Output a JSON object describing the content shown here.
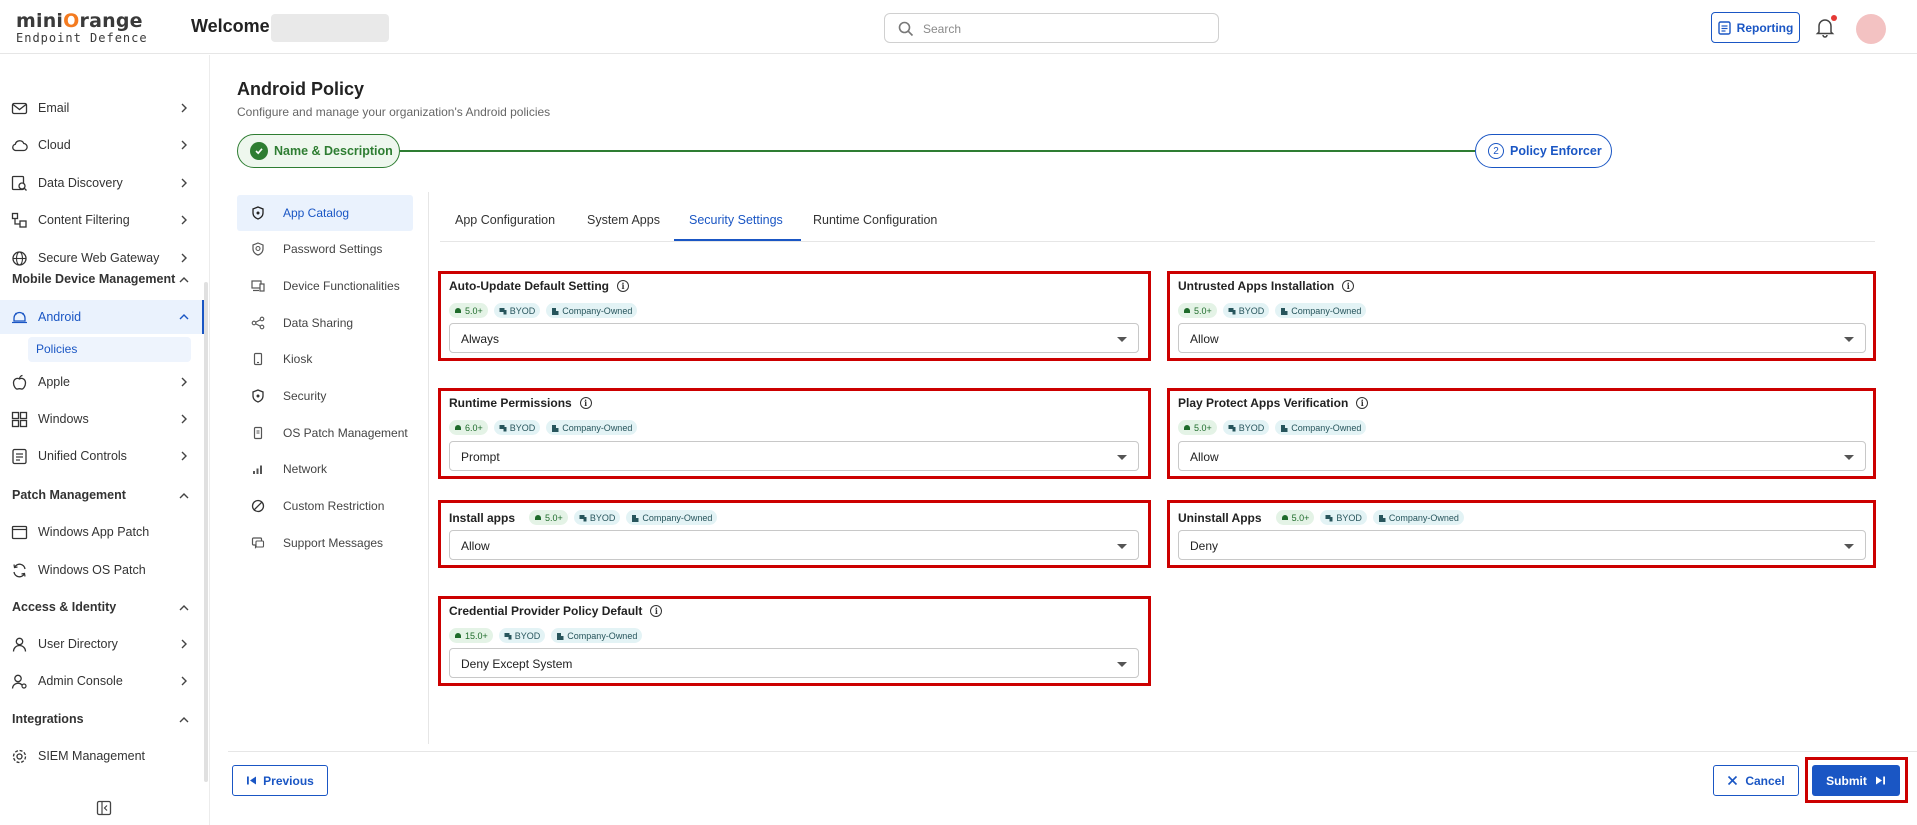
{
  "header": {
    "logo_main_a": "mini",
    "logo_main_o": "O",
    "logo_main_b": "range",
    "logo_sub": "Endpoint Defence",
    "welcome": "Welcome,",
    "search_placeholder": "Search",
    "reporting_label": "Reporting"
  },
  "sidebar": {
    "items": [
      {
        "label": "Email",
        "icon": "mail-icon"
      },
      {
        "label": "Cloud",
        "icon": "cloud-icon"
      },
      {
        "label": "Data Discovery",
        "icon": "data-discovery-icon"
      },
      {
        "label": "Content Filtering",
        "icon": "content-filter-icon"
      },
      {
        "label": "Secure Web Gateway",
        "icon": "globe-icon"
      }
    ],
    "mdm_section": "Mobile Device Management",
    "android": "Android",
    "policies": "Policies",
    "apple": "Apple",
    "windows": "Windows",
    "unified_controls": "Unified Controls",
    "patch_section": "Patch Management",
    "windows_app_patch": "Windows App Patch",
    "windows_os_patch": "Windows OS Patch",
    "access_section": "Access & Identity",
    "user_directory": "User Directory",
    "admin_console": "Admin Console",
    "integrations_section": "Integrations",
    "siem": "SIEM Management"
  },
  "main": {
    "title": "Android Policy",
    "subtitle": "Configure and manage your organization's Android policies",
    "steps": [
      {
        "label": "Name & Description",
        "state": "completed"
      },
      {
        "label": "Policy Enforcer",
        "number": "2",
        "state": "active"
      }
    ]
  },
  "left_nav": [
    {
      "label": "App Catalog",
      "icon": "shield-icon"
    },
    {
      "label": "Password Settings",
      "icon": "password-shield-icon"
    },
    {
      "label": "Device Functionalities",
      "icon": "devices-icon"
    },
    {
      "label": "Data Sharing",
      "icon": "share-icon"
    },
    {
      "label": "Kiosk",
      "icon": "kiosk-icon"
    },
    {
      "label": "Security",
      "icon": "security-shield-icon"
    },
    {
      "label": "OS Patch Management",
      "icon": "phone-patch-icon"
    },
    {
      "label": "Network",
      "icon": "signal-icon"
    },
    {
      "label": "Custom Restriction",
      "icon": "block-icon"
    },
    {
      "label": "Support Messages",
      "icon": "message-icon"
    }
  ],
  "tabs": [
    "App Configuration",
    "System Apps",
    "Security Settings",
    "Runtime Configuration"
  ],
  "badge_labels": {
    "byod": "BYOD",
    "company": "Company-Owned"
  },
  "settings": {
    "auto_update": {
      "title": "Auto-Update Default Setting",
      "version": "5.0+",
      "value": "Always"
    },
    "untrusted_apps": {
      "title": "Untrusted Apps Installation",
      "version": "5.0+",
      "value": "Allow"
    },
    "runtime_permissions": {
      "title": "Runtime Permissions",
      "version": "6.0+",
      "value": "Prompt"
    },
    "play_protect": {
      "title": "Play Protect Apps Verification",
      "version": "5.0+",
      "value": "Allow"
    },
    "install_apps": {
      "title": "Install apps",
      "version": "5.0+",
      "value": "Allow"
    },
    "uninstall_apps": {
      "title": "Uninstall Apps",
      "version": "5.0+",
      "value": "Deny"
    },
    "credential_provider": {
      "title": "Credential Provider Policy Default",
      "version": "15.0+",
      "value": "Deny Except System"
    }
  },
  "footer": {
    "previous": "Previous",
    "cancel": "Cancel",
    "submit": "Submit"
  }
}
